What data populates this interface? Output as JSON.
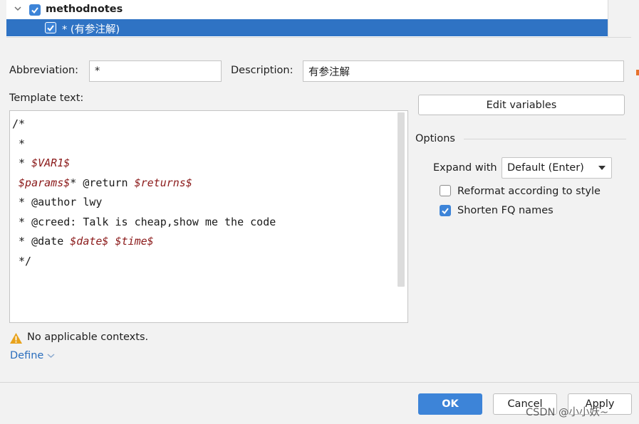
{
  "tree": {
    "group_label": "methodnotes",
    "item_label": "* (有参注解)"
  },
  "form": {
    "abbreviation_label": "Abbreviation:",
    "abbreviation_value": "*",
    "description_label": "Description:",
    "description_value": "有参注解",
    "template_label": "Template text:"
  },
  "template_lines": [
    [
      {
        "t": "/*",
        "v": false
      }
    ],
    [
      {
        "t": " *",
        "v": false
      }
    ],
    [
      {
        "t": " * ",
        "v": false
      },
      {
        "t": "$VAR1$",
        "v": true
      }
    ],
    [
      {
        "t": " ",
        "v": false
      },
      {
        "t": "$params$",
        "v": true
      },
      {
        "t": "* @return ",
        "v": false
      },
      {
        "t": "$returns$",
        "v": true
      }
    ],
    [
      {
        "t": " * @author lwy",
        "v": false
      }
    ],
    [
      {
        "t": " * @creed: Talk is cheap,show me the code",
        "v": false
      }
    ],
    [
      {
        "t": " * @date ",
        "v": false
      },
      {
        "t": "$date$",
        "v": true
      },
      {
        "t": " ",
        "v": false
      },
      {
        "t": "$time$",
        "v": true
      }
    ],
    [
      {
        "t": " */",
        "v": false
      }
    ]
  ],
  "edit_variables_label": "Edit variables",
  "options": {
    "title": "Options",
    "expand_label": "Expand with",
    "expand_value": "Default (Enter)",
    "reformat_label": "Reformat according to style",
    "reformat_checked": false,
    "shorten_label": "Shorten FQ names",
    "shorten_checked": true
  },
  "contexts": {
    "warning_text": "No applicable contexts.",
    "define_label": "Define"
  },
  "footer": {
    "ok_label": "OK",
    "cancel_label": "Cancel",
    "apply_label": "Apply",
    "watermark": "CSDN @小小妖~"
  },
  "colors": {
    "accent": "#3d84d8",
    "selection": "#2f73c4",
    "template_variable": "#8b1a1a",
    "warning": "#e8a21b",
    "link": "#2a6ebd"
  }
}
